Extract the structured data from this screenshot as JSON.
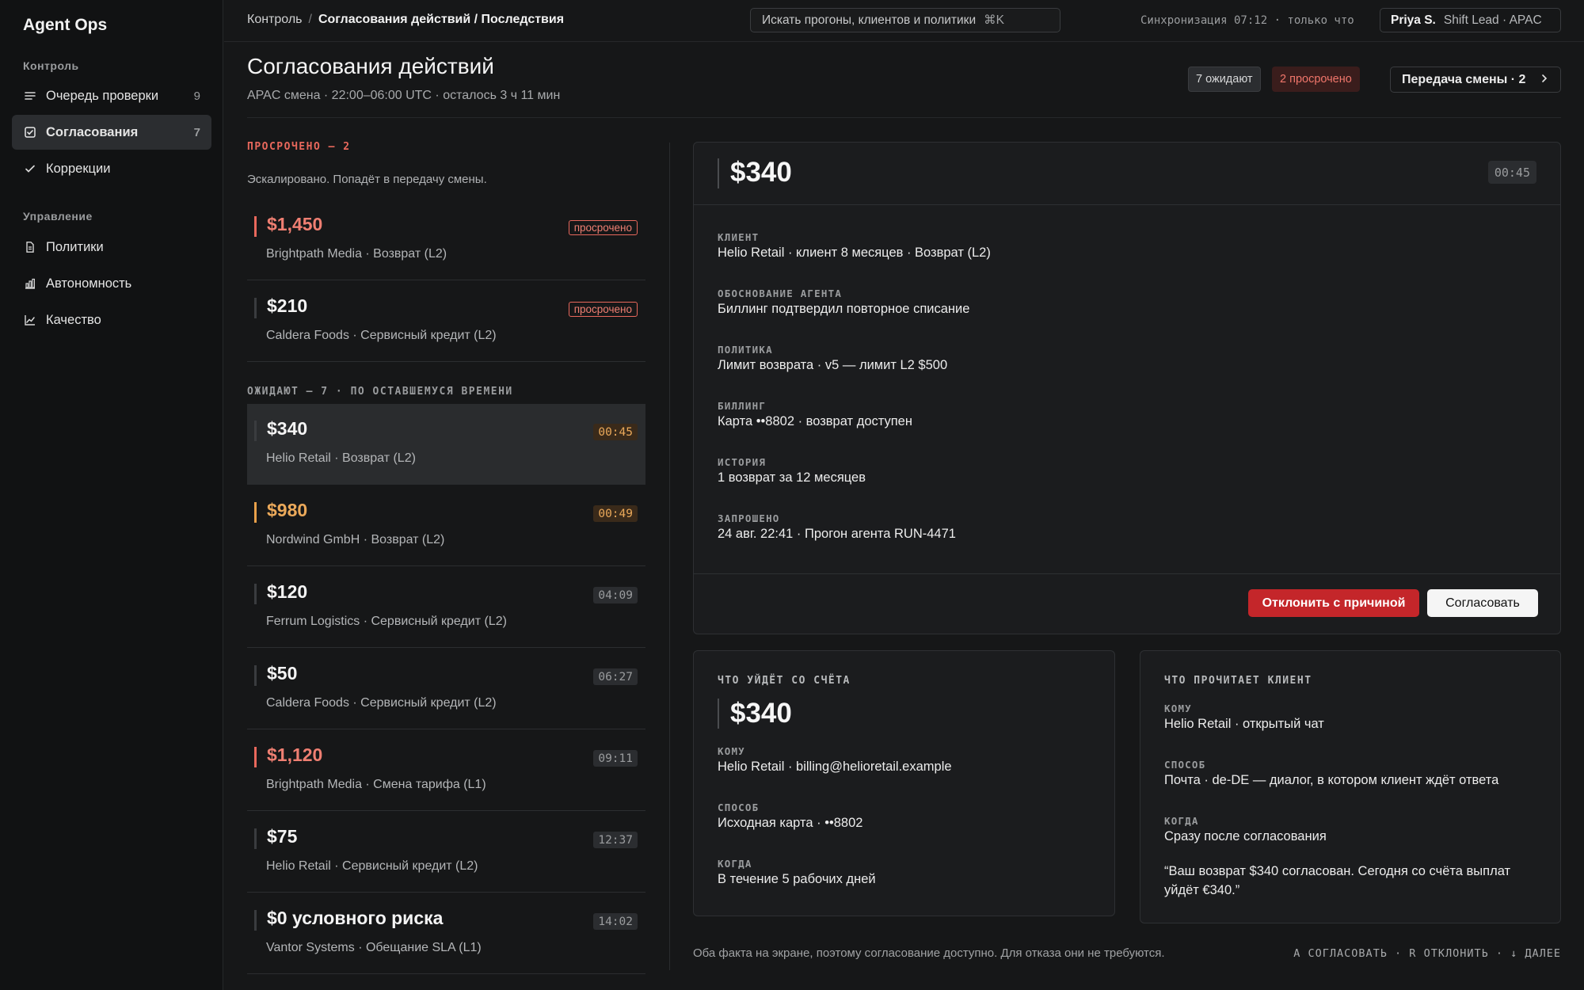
{
  "app": {
    "name": "Agent Ops"
  },
  "sidebar": {
    "sections": [
      {
        "label": "Контроль"
      },
      {
        "label": "Управление"
      }
    ],
    "items": [
      {
        "label": "Очередь проверки",
        "count": "9",
        "icon": "list-icon"
      },
      {
        "label": "Согласования",
        "count": "7",
        "icon": "checkbox-icon",
        "active": true
      },
      {
        "label": "Коррекции",
        "count": "",
        "icon": "check-icon"
      },
      {
        "label": "Политики",
        "count": "",
        "icon": "document-icon"
      },
      {
        "label": "Автономность",
        "count": "",
        "icon": "bar-chart-icon"
      },
      {
        "label": "Качество",
        "count": "",
        "icon": "line-chart-icon"
      }
    ]
  },
  "topbar": {
    "breadcrumb_root": "Контроль",
    "breadcrumb_sep": "/",
    "breadcrumb_current": "Согласования действий / Последствия",
    "search_placeholder": "Искать прогоны, клиентов и политики",
    "search_shortcut": "⌘K",
    "sync_status": "Синхронизация 07:12 · только что",
    "user_name": "Priya S.",
    "user_role": "Shift Lead · APAC"
  },
  "header": {
    "title": "Согласования действий",
    "subtitle": "APAC смена · 22:00–06:00 UTC · осталось 3 ч 11 мин",
    "badge_waiting": "7 ожидают",
    "badge_overdue": "2 просрочено",
    "handoff_button": "Передача смены · 2"
  },
  "queue": {
    "overdue_label": "ПРОСРОЧЕНО — 2",
    "overdue_note": "Эскалировано. Попадёт в передачу смены.",
    "overdue_tag": "просрочено",
    "overdue_items": [
      {
        "amount": "$1,450",
        "meta": "Brightpath Media · Возврат (L2)"
      },
      {
        "amount": "$210",
        "meta": "Caldera Foods · Сервисный кредит (L2)"
      }
    ],
    "waiting_label": "ОЖИДАЮТ — 7 · ПО ОСТАВШЕМУСЯ ВРЕМЕНИ",
    "waiting_items": [
      {
        "amount": "$340",
        "meta": "Helio Retail · Возврат (L2)",
        "timer": "00:45",
        "tone": "orange",
        "amount_tone": "",
        "bar": "",
        "selected": true
      },
      {
        "amount": "$980",
        "meta": "Nordwind GmbH · Возврат (L2)",
        "timer": "00:49",
        "tone": "orange",
        "amount_tone": "orange",
        "bar": "orange"
      },
      {
        "amount": "$120",
        "meta": "Ferrum Logistics · Сервисный кредит (L2)",
        "timer": "04:09",
        "tone": "",
        "amount_tone": "",
        "bar": ""
      },
      {
        "amount": "$50",
        "meta": "Caldera Foods · Сервисный кредит (L2)",
        "timer": "06:27",
        "tone": "",
        "amount_tone": "",
        "bar": ""
      },
      {
        "amount": "$1,120",
        "meta": "Brightpath Media · Смена тарифа (L1)",
        "timer": "09:11",
        "tone": "",
        "amount_tone": "red",
        "bar": "red"
      },
      {
        "amount": "$75",
        "meta": "Helio Retail · Сервисный кредит (L2)",
        "timer": "12:37",
        "tone": "",
        "amount_tone": "",
        "bar": ""
      },
      {
        "amount": "$0 условного риска",
        "meta": "Vantor Systems · Обещание SLA (L1)",
        "timer": "14:02",
        "tone": "",
        "amount_tone": "",
        "bar": ""
      }
    ]
  },
  "detail": {
    "amount": "$340",
    "timer": "00:45",
    "fields": [
      {
        "label": "КЛИЕНТ",
        "value": "Helio Retail · клиент 8 месяцев · Возврат (L2)"
      },
      {
        "label": "ОБОСНОВАНИЕ АГЕНТА",
        "value": "Биллинг подтвердил повторное списание"
      },
      {
        "label": "ПОЛИТИКА",
        "value": "Лимит возврата · v5 — лимит L2 $500"
      },
      {
        "label": "БИЛЛИНГ",
        "value": "Карта ••8802 · возврат доступен"
      },
      {
        "label": "ИСТОРИЯ",
        "value": "1 возврат за 12 месяцев"
      },
      {
        "label": "ЗАПРОШЕНО",
        "value": "24 авг. 22:41 · Прогон агента RUN-4471"
      }
    ],
    "reject_button": "Отклонить с причиной",
    "approve_button": "Согласовать"
  },
  "money_card": {
    "title": "ЧТО УЙДЁТ СО СЧЁТА",
    "amount": "$340",
    "fields": [
      {
        "label": "КОМУ",
        "value": "Helio Retail · billing@helioretail.example"
      },
      {
        "label": "СПОСОБ",
        "value": "Исходная карта · ••8802"
      },
      {
        "label": "КОГДА",
        "value": "В течение 5 рабочих дней"
      }
    ]
  },
  "customer_card": {
    "title": "ЧТО ПРОЧИТАЕТ КЛИЕНТ",
    "fields": [
      {
        "label": "КОМУ",
        "value": "Helio Retail · открытый чат"
      },
      {
        "label": "СПОСОБ",
        "value": "Почта · de-DE — диалог, в котором клиент ждёт ответа"
      },
      {
        "label": "КОГДА",
        "value": "Сразу после согласования"
      }
    ],
    "quote": "“Ваш возврат $340 согласован. Сегодня со счёта выплат уйдёт €340.”"
  },
  "footer": {
    "note": "Оба факта на экране, поэтому согласование доступно. Для отказа они не требуются.",
    "shortcuts": "A СОГЛАСОВАТЬ · R ОТКЛОНИТЬ · ↓ ДАЛЕЕ"
  }
}
